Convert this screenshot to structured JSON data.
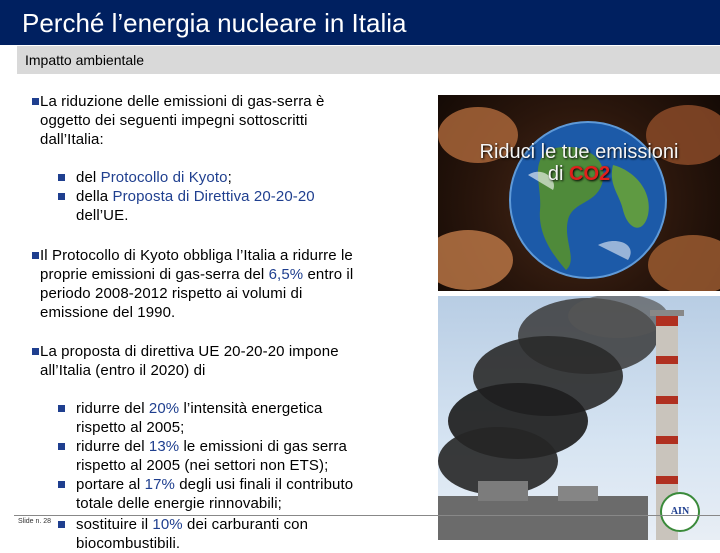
{
  "title": "Perché l’energia nucleare in Italia",
  "subtitle": "Impatto ambientale",
  "bullets": {
    "b1": {
      "l1": "La riduzione delle emissioni di gas-serra è",
      "l2": "oggetto dei seguenti impegni sottoscritti",
      "l3": "dall’Italia:"
    },
    "s1": {
      "pre": "del ",
      "hl": "Protocollo di Kyoto",
      "post": ";"
    },
    "s2": {
      "pre": "della ",
      "hl": "Proposta di Direttiva 20-20-20",
      "l2": "dell’UE."
    },
    "b2": {
      "l1": "Il Protocollo di Kyoto obbliga l’Italia a ridurre le",
      "l2pre": "proprie emissioni di gas-serra del ",
      "l2hl": "6,5%",
      "l2post": " entro il",
      "l3": "periodo 2008-2012 rispetto ai volumi di",
      "l4": "emissione del 1990."
    },
    "b3": {
      "l1": "La proposta di direttiva UE 20-20-20 impone",
      "l2": "all’Italia (entro il 2020) di"
    },
    "s3": {
      "pre": "ridurre del ",
      "hl": "20%",
      "post": " l’intensità energetica",
      "l2": "rispetto al 2005;"
    },
    "s4": {
      "pre": "ridurre del ",
      "hl": "13%",
      "post": " le emissioni di gas serra",
      "l2": "rispetto al 2005 (nei settori non ETS);"
    },
    "s5": {
      "pre": "portare al ",
      "hl": "17%",
      "post": " degli usi finali il contributo",
      "l2": "totale delle energie rinnovabili;"
    },
    "s6": {
      "pre": "sostituire il ",
      "hl": "10%",
      "post": " dei carburanti con",
      "l2": "biocombustibili."
    }
  },
  "image1": {
    "line1": "Riduci le tue emissioni",
    "line2pre": "di ",
    "line2hl": "CO2"
  },
  "logo": {
    "text": "AIN"
  },
  "footer": {
    "slide": "Slide n. 28"
  },
  "colors": {
    "title_bar": "#002060",
    "highlight": "#1f3f8f",
    "subtitle_bar": "#d9d9d9"
  }
}
